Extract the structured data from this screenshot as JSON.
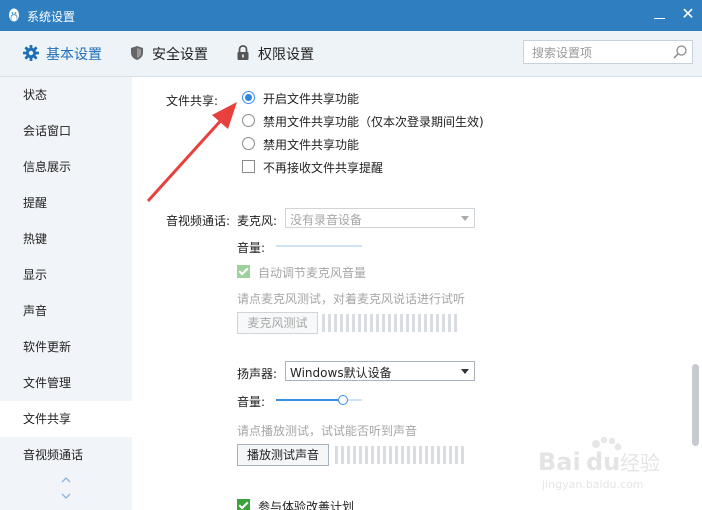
{
  "window": {
    "title": "系统设置"
  },
  "toolbar": {
    "tabs": [
      {
        "label": "基本设置",
        "icon": "gear-icon"
      },
      {
        "label": "安全设置",
        "icon": "shield-icon"
      },
      {
        "label": "权限设置",
        "icon": "lock-icon"
      }
    ],
    "search_placeholder": "搜索设置项"
  },
  "sidebar": {
    "items": [
      "状态",
      "会话窗口",
      "信息展示",
      "提醒",
      "热键",
      "显示",
      "声音",
      "软件更新",
      "文件管理",
      "文件共享",
      "音视频通话"
    ],
    "active": "文件共享"
  },
  "file_share": {
    "label": "文件共享:",
    "options": [
      {
        "label": "开启文件共享功能",
        "selected": true
      },
      {
        "label": "禁用文件共享功能（仅本次登录期间生效)",
        "selected": false
      },
      {
        "label": "禁用文件共享功能",
        "selected": false
      }
    ],
    "checkbox_label": "不再接收文件共享提醒",
    "checkbox_checked": false
  },
  "av_call": {
    "label": "音视频通话:",
    "mic_label": "麦克风:",
    "mic_device": "没有录音设备",
    "mic_volume_label": "音量:",
    "auto_adjust_label": "自动调节麦克风音量",
    "mic_test_hint": "请点麦克风测试，对着麦克风说话进行试听",
    "mic_test_button": "麦克风测试",
    "speaker_label": "扬声器:",
    "speaker_device": "Windows默认设备",
    "speaker_volume_label": "音量:",
    "speaker_volume": 0.78,
    "speaker_test_hint": "请点播放测试，试试能否听到声音",
    "speaker_test_button": "播放测试声音",
    "experience_label": "参与体验改善计划",
    "experience_checked": true
  },
  "watermark": {
    "text": "Baidu经验",
    "sub": "jingyan.baidu.com"
  },
  "colors": {
    "titlebar": "#2f7fc0",
    "accent": "#2a86e0",
    "arrow": "#e8413d",
    "check": "#3aa33a"
  }
}
